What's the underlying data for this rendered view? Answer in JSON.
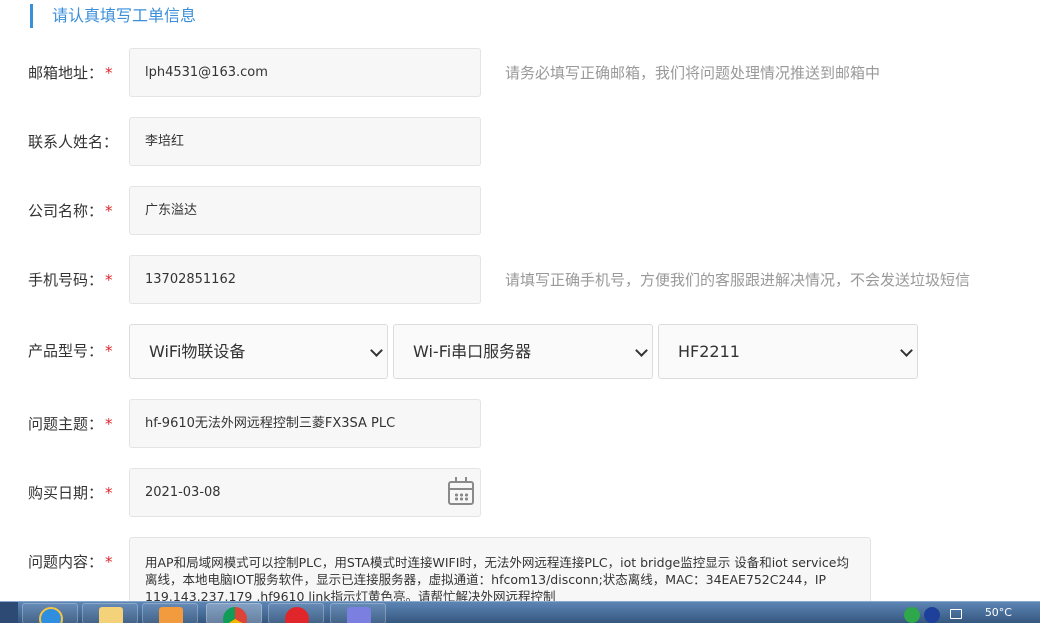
{
  "section": {
    "title": "请认真填写工单信息"
  },
  "required_mark": "*",
  "form": {
    "email": {
      "label": "邮箱地址：",
      "value": "lph4531@163.com",
      "hint": "请务必填写正确邮箱，我们将问题处理情况推送到邮箱中"
    },
    "contact": {
      "label": "联系人姓名：",
      "value": "李培红"
    },
    "company": {
      "label": "公司名称：",
      "value": "广东溢达"
    },
    "phone": {
      "label": "手机号码：",
      "value": "13702851162",
      "hint": "请填写正确手机号，方便我们的客服跟进解决情况，不会发送垃圾短信"
    },
    "product": {
      "label": "产品型号：",
      "category": "WiFi物联设备",
      "subcategory": "Wi-Fi串口服务器",
      "model": "HF2211"
    },
    "subject": {
      "label": "问题主题：",
      "value": "hf-9610无法外网远程控制三菱FX3SA PLC"
    },
    "purchase_date": {
      "label": "购买日期：",
      "value": "2021-03-08"
    },
    "content": {
      "label": "问题内容：",
      "value": "用AP和局域网模式可以控制PLC，用STA模式时连接WIFI时，无法外网远程连接PLC，iot bridge监控显示 设备和iot service均离线，本地电脑IOT服务软件，显示已连接服务器，虚拟通道：hfcom13/disconn;状态离线，MAC：34EAE752C244，IP 119.143.237.179 ,hf9610 link指示灯黄色亮。请帮忙解决外网远程控制"
    }
  },
  "taskbar": {
    "apps": [
      "internet-explorer",
      "file-explorer",
      "media-player",
      "chrome",
      "antivirus",
      "app-6"
    ],
    "temperature": "50°C"
  },
  "colors": {
    "accent": "#3b8fd9",
    "required": "#e0262b",
    "hint": "#999999"
  }
}
